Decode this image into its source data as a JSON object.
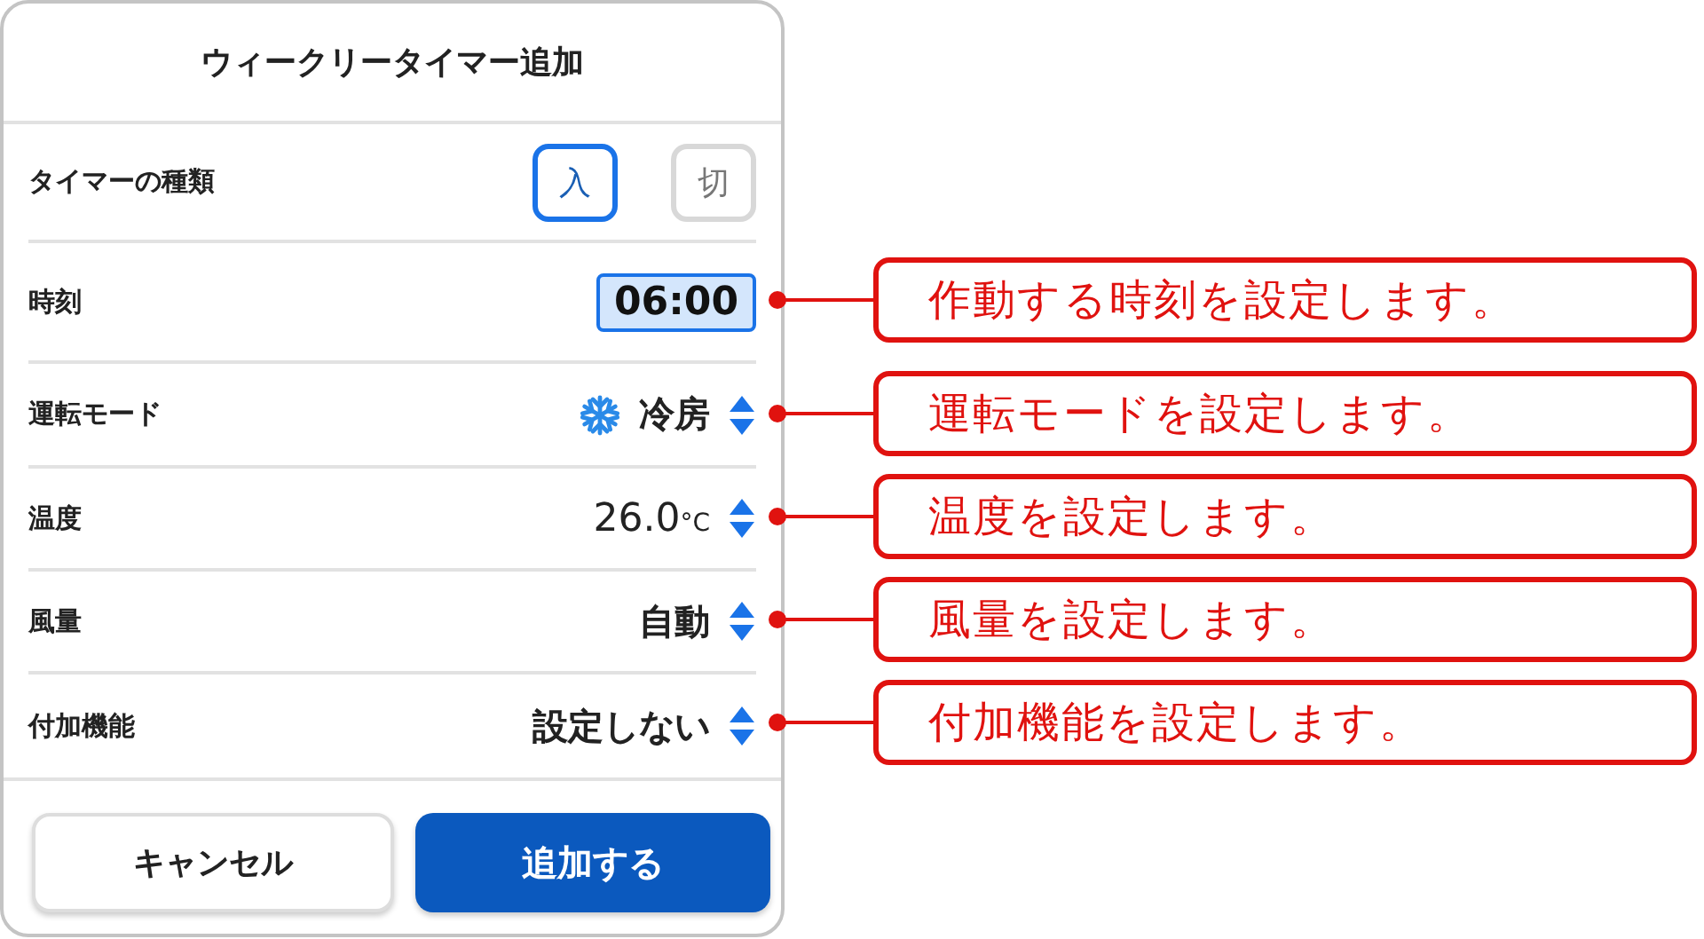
{
  "title": "ウィークリータイマー追加",
  "rows": [
    {
      "kind": "toggle",
      "label": "タイマーの種類",
      "options": [
        {
          "label": "入",
          "selected": true
        },
        {
          "label": "切",
          "selected": false
        }
      ]
    },
    {
      "kind": "time",
      "label": "時刻",
      "value": "06:00",
      "selected": true
    },
    {
      "kind": "mode",
      "label": "運転モード",
      "value": "冷房"
    },
    {
      "kind": "select",
      "label": "温度",
      "value": "26.0",
      "unit": "°C"
    },
    {
      "kind": "select",
      "label": "風量",
      "value": "自動"
    },
    {
      "kind": "select",
      "label": "付加機能",
      "value": "設定しない"
    }
  ],
  "buttons": [
    {
      "label": "キャンセル",
      "kind": "secondary"
    },
    {
      "label": "追加する",
      "kind": "primary"
    }
  ],
  "callouts": [
    "作動する時刻を設定します。",
    "運転モードを設定します。",
    "温度を設定します。",
    "風量を設定します。",
    "付加機能を設定します。"
  ]
}
